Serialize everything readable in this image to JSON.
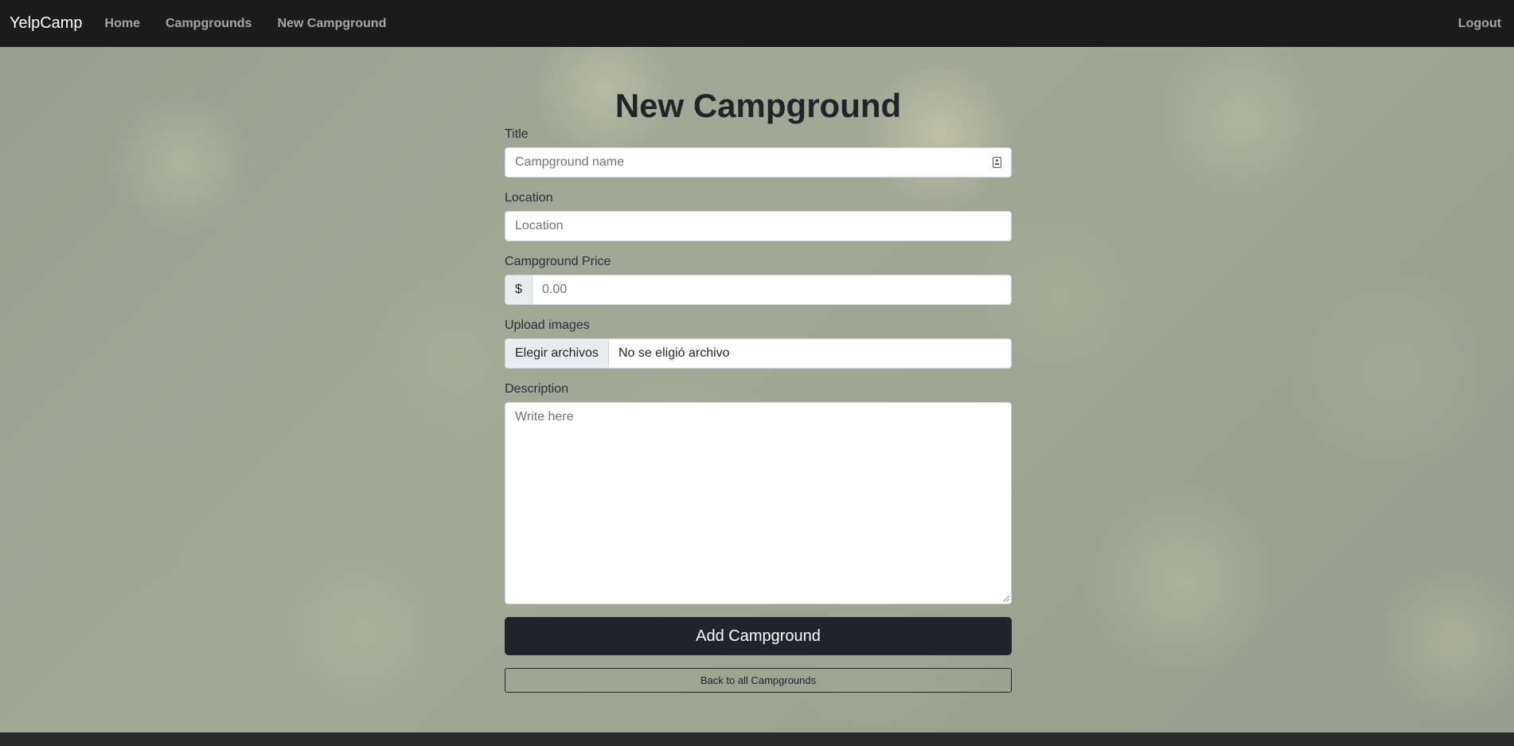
{
  "navbar": {
    "brand": "YelpCamp",
    "links": [
      "Home",
      "Campgrounds",
      "New Campground"
    ],
    "logout": "Logout"
  },
  "form": {
    "heading": "New Campground",
    "title": {
      "label": "Title",
      "placeholder": "Campground name",
      "icon": "id-card-icon"
    },
    "location": {
      "label": "Location",
      "placeholder": "Location"
    },
    "price": {
      "label": "Campground Price",
      "prefix": "$",
      "placeholder": "0.00"
    },
    "images": {
      "label": "Upload images",
      "button": "Elegir archivos",
      "status": "No se eligió archivo"
    },
    "description": {
      "label": "Description",
      "placeholder": "Write here"
    },
    "submit": "Add Campground",
    "back": "Back to all Campgrounds"
  },
  "colors": {
    "navbar_bg": "#1b1b1b",
    "primary_button": "#212529",
    "nav_link": "#a6a6a6"
  }
}
